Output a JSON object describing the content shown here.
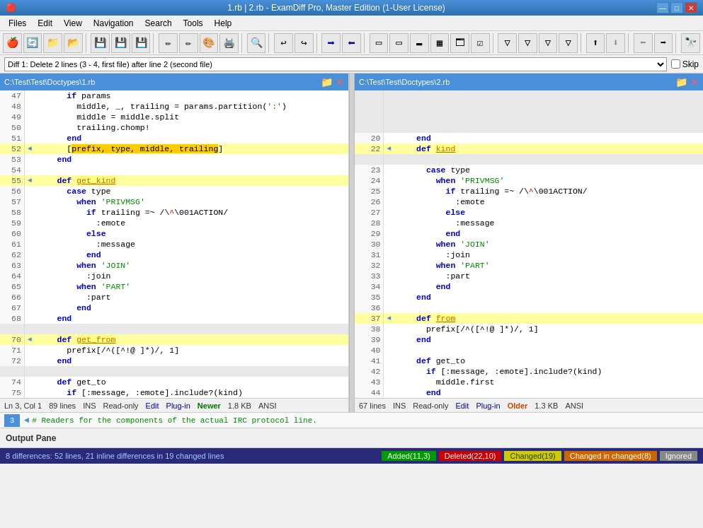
{
  "titlebar": {
    "title": "1.rb | 2.rb - ExamDiff Pro, Master Edition (1-User License)",
    "min": "—",
    "max": "□",
    "close": "✕"
  },
  "menu": {
    "items": [
      "Files",
      "Edit",
      "View",
      "Navigation",
      "Search",
      "Tools",
      "Help"
    ]
  },
  "diffnav": {
    "current": "Diff 1: Delete 2 lines (3 - 4, first file) after line 2 (second file)",
    "skip_label": "Skip"
  },
  "left_pane": {
    "path": "C:\\Test\\Test\\Doctypes\\1.rb",
    "status": {
      "ln": "Ln 3, Col 1",
      "lines": "89 lines",
      "ins": "INS",
      "readonly": "Read-only",
      "edit": "Edit",
      "plugin": "Plug-in",
      "version": "Newer",
      "size": "1.8 KB",
      "encoding": "ANSI"
    }
  },
  "right_pane": {
    "path": "C:\\Test\\Test\\Doctypes\\2.rb",
    "status": {
      "lines": "67 lines",
      "ins": "INS",
      "readonly": "Read-only",
      "edit": "Edit",
      "plugin": "Plug-in",
      "version": "Older",
      "size": "1.3 KB",
      "encoding": "ANSI"
    }
  },
  "bottom_row": {
    "num": "3",
    "code": "  # Readers for the components of the actual IRC protocol line."
  },
  "output_pane": {
    "label": "Output Pane"
  },
  "statusbar": {
    "diff_summary": "8 differences: 52 lines, 21 inline differences in 19 changed lines",
    "added": "Added(11,3)",
    "deleted": "Deleted(22,10)",
    "changed": "Changed(19)",
    "changed_in": "Changed in changed(8)",
    "ignored": "Ignored"
  }
}
